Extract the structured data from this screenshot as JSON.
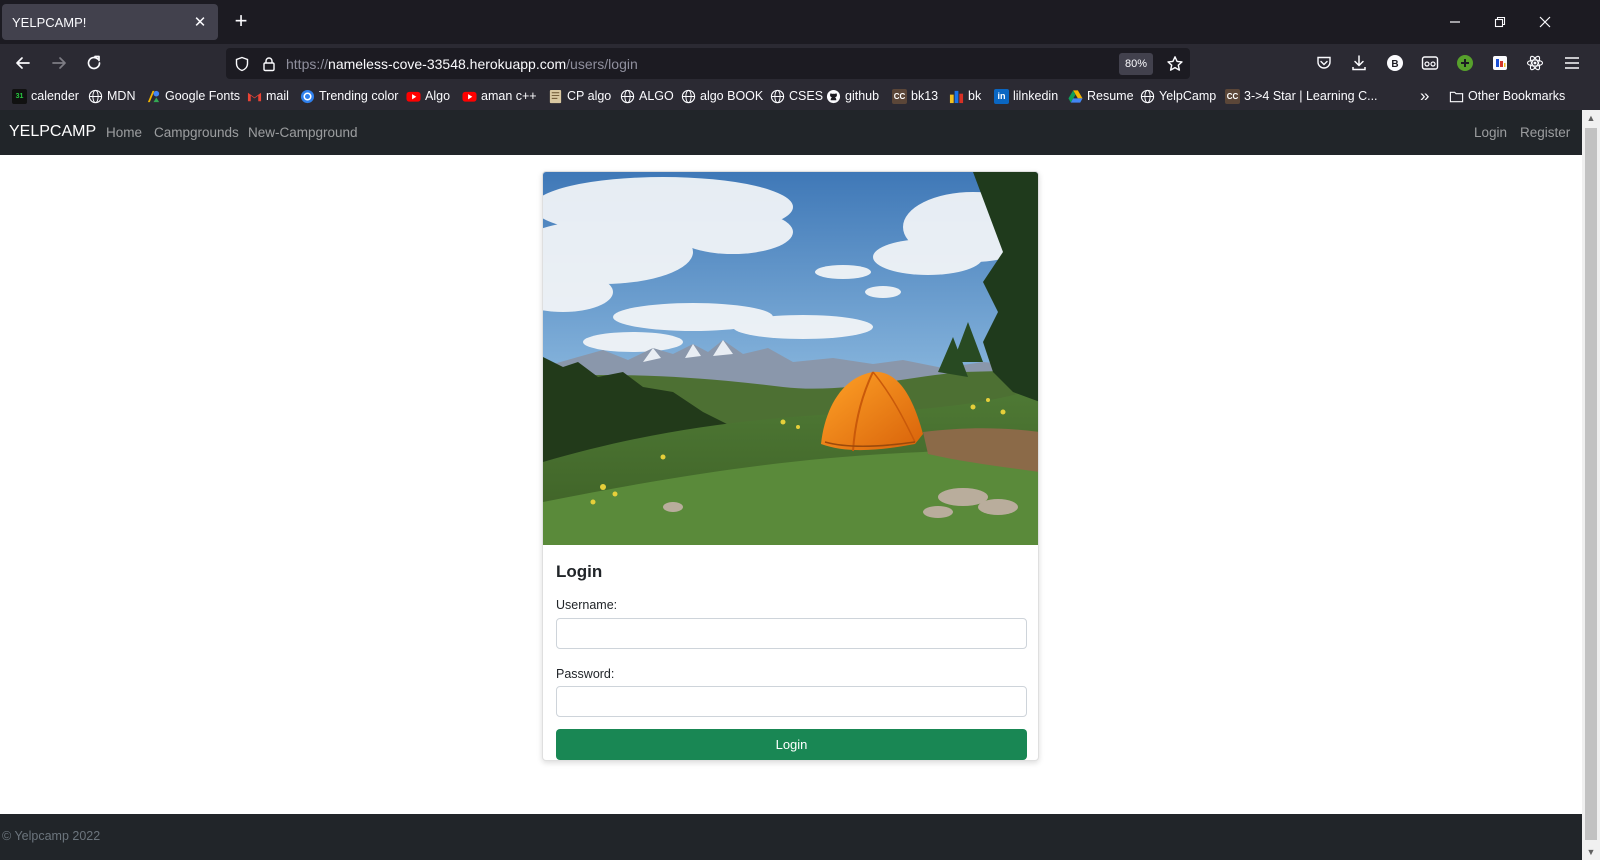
{
  "browser": {
    "tab_title": "YELPCAMP!",
    "tab_close": "✕",
    "new_tab": "+",
    "url_scheme": "https://",
    "url_host": "nameless-cove-33548.herokuapp.com",
    "url_path": "/users/login",
    "zoom": "80%",
    "window_minimize": "—",
    "window_restore": "❐",
    "window_close": "✕",
    "bookmarks": [
      {
        "label": "calender",
        "icon": "calendar-favicon",
        "color": "#0b8a3a"
      },
      {
        "label": "MDN",
        "icon": "globe-icon"
      },
      {
        "label": "Google Fonts",
        "icon": "google-fonts-favicon"
      },
      {
        "label": "mail",
        "icon": "gmail-favicon"
      },
      {
        "label": "Trending color",
        "icon": "trending-color-favicon"
      },
      {
        "label": "Algo",
        "icon": "youtube-favicon"
      },
      {
        "label": "aman c++",
        "icon": "youtube-favicon"
      },
      {
        "label": "CP algo",
        "icon": "cp-algo-favicon"
      },
      {
        "label": "ALGO",
        "icon": "globe-icon"
      },
      {
        "label": "algo BOOK",
        "icon": "globe-icon"
      },
      {
        "label": "CSES",
        "icon": "globe-icon"
      },
      {
        "label": "github",
        "icon": "github-favicon"
      },
      {
        "label": "bk13",
        "icon": "codechef-favicon"
      },
      {
        "label": "bk",
        "icon": "codeforces-favicon"
      },
      {
        "label": "lilnkedin",
        "icon": "linkedin-favicon"
      },
      {
        "label": "Resume",
        "icon": "google-drive-favicon"
      },
      {
        "label": "YelpCamp",
        "icon": "globe-icon"
      },
      {
        "label": "3->4 Star | Learning C...",
        "icon": "codechef-favicon"
      }
    ],
    "overflow": "»",
    "other_bookmarks": "Other Bookmarks"
  },
  "site": {
    "brand": "YELPCAMP",
    "nav_links": [
      "Home",
      "Campgrounds",
      "New-Campground"
    ],
    "login_link": "Login",
    "register_link": "Register",
    "hero_image": "campsite-orange-tent-mountains-image",
    "login_form": {
      "title": "Login",
      "username_label": "Username:",
      "username_value": "",
      "password_label": "Password:",
      "password_value": "",
      "submit_label": "Login"
    },
    "footer": "© Yelpcamp 2022"
  },
  "colors": {
    "nav_bg": "#212529",
    "button_green": "#198754",
    "browser_bg": "#1c1b22",
    "toolbar_bg": "#2b2a33"
  }
}
